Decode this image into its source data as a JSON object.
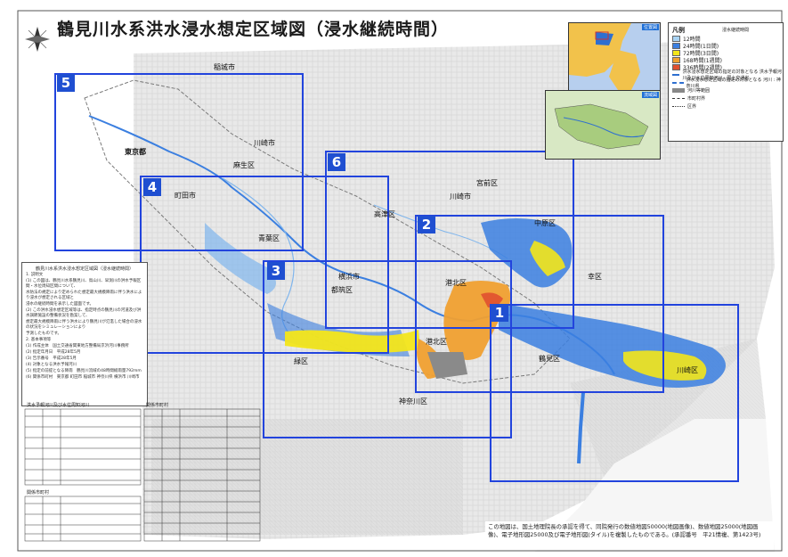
{
  "title": "鶴見川水系洪水浸水想定区域図（浸水継続時間）",
  "legend": {
    "heading": "凡例",
    "subheading": "浸水継続時間",
    "duration_classes": [
      {
        "label": "12時間",
        "color": "#a9d4f5"
      },
      {
        "label": "24時間(1日間)",
        "color": "#3b7fe0"
      },
      {
        "label": "72時間(3日間)",
        "color": "#f3e61a"
      },
      {
        "label": "168時間(1週間)",
        "color": "#f0a030"
      },
      {
        "label": "336時間(2週間)",
        "color": "#e05030"
      }
    ],
    "line_items": [
      "洪水浸水想定区域の指定の対象となる 洪水予報河川及び水位周知河川 : 国土交通省",
      "洪水浸水想定区域の指定の対象となる 河川 : 神奈川県",
      "河川等範囲",
      "市町村界",
      "区界"
    ]
  },
  "inset_labels": [
    "位置図",
    "流域図"
  ],
  "cities": [
    "稲城市",
    "川崎市",
    "東京都",
    "麻生区",
    "町田市",
    "青葉区",
    "横浜市",
    "都筑区",
    "港北区",
    "川崎市",
    "中原区",
    "高津区",
    "宮前区",
    "幸区",
    "鶴見区",
    "川崎区",
    "神奈川区",
    "緑区",
    "港北区"
  ],
  "sheet_numbers": [
    "1",
    "2",
    "3",
    "4",
    "5",
    "6"
  ],
  "notes": {
    "title": "鶴見川水系洪水浸水想定区域図（浸水継続時間）",
    "lines": [
      "1. 説明文",
      "(1) この図は、鶴見川水系鶴見川、鳥山川、早渕川の洪水予報区間・水位周知区間について、",
      "水防法の規定により定められた想定最大規模降雨に伴う洪水により浸水が想定される区域と",
      "浸水の継続時間を表示した図面です。",
      "(2) この洪水浸水想定区域等は、指定時点の鶴見川の河道及び洪水調節施設の整備状況を勘案して、",
      "想定最大規模降雨に伴う洪水により鶴見川が氾濫した場合の浸水の状況をシミュレーションにより",
      "予測したものです。",
      "2. 基本事項等",
      "(1) 作成主体　国土交通省関東地方整備局京浜河川事務所",
      "(2) 指定年月日　平成28年5月",
      "(3) 告示番号　平成28年5月",
      "(4) 対象となる洪水予報河川",
      "(5) 指定の前提となる降雨　鶴見川流域の48時間総雨量792mm",
      "(6) 関係市町村　東京都 町田市 稲城市 神奈川県 横浜市 川崎市"
    ]
  },
  "table_titles": [
    "洪水予報河川及び水位周知河川",
    "関係市町村",
    "関係市町村"
  ],
  "footnote": "この地図は、国土地理院長の承認を得て、同院発行の数値地図50000(地図画像)、数値地図25000(地図画像)、電子地形図25000及び電子地形図(タイル)を複製したものである。(承認番号　平21情複、第1423号)"
}
